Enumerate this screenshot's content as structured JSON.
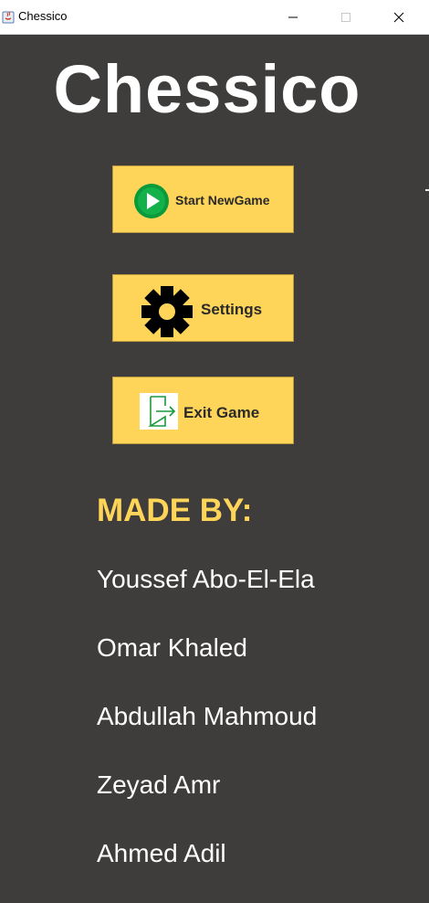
{
  "window": {
    "title": "Chessico",
    "controls": {
      "minimize_icon": "minimize-icon",
      "maximize_icon": "maximize-icon",
      "close_icon": "close-icon"
    }
  },
  "main": {
    "heading": "Chessico",
    "buttons": [
      {
        "label": "Start NewGame",
        "icon": "play-icon"
      },
      {
        "label": "Settings",
        "icon": "gear-icon"
      },
      {
        "label": "Exit Game",
        "icon": "exit-icon"
      }
    ],
    "credits": {
      "title": "MADE BY:",
      "authors": [
        "Youssef Abo-El-Ela",
        "Omar Khaled",
        "Abdullah Mahmoud",
        "Zeyad Amr",
        "Ahmed Adil"
      ]
    }
  },
  "colors": {
    "background": "#3f3d3c",
    "button": "#fed558",
    "accent": "#fed558",
    "text": "#ffffff",
    "play_green": "#0a9a3c"
  }
}
